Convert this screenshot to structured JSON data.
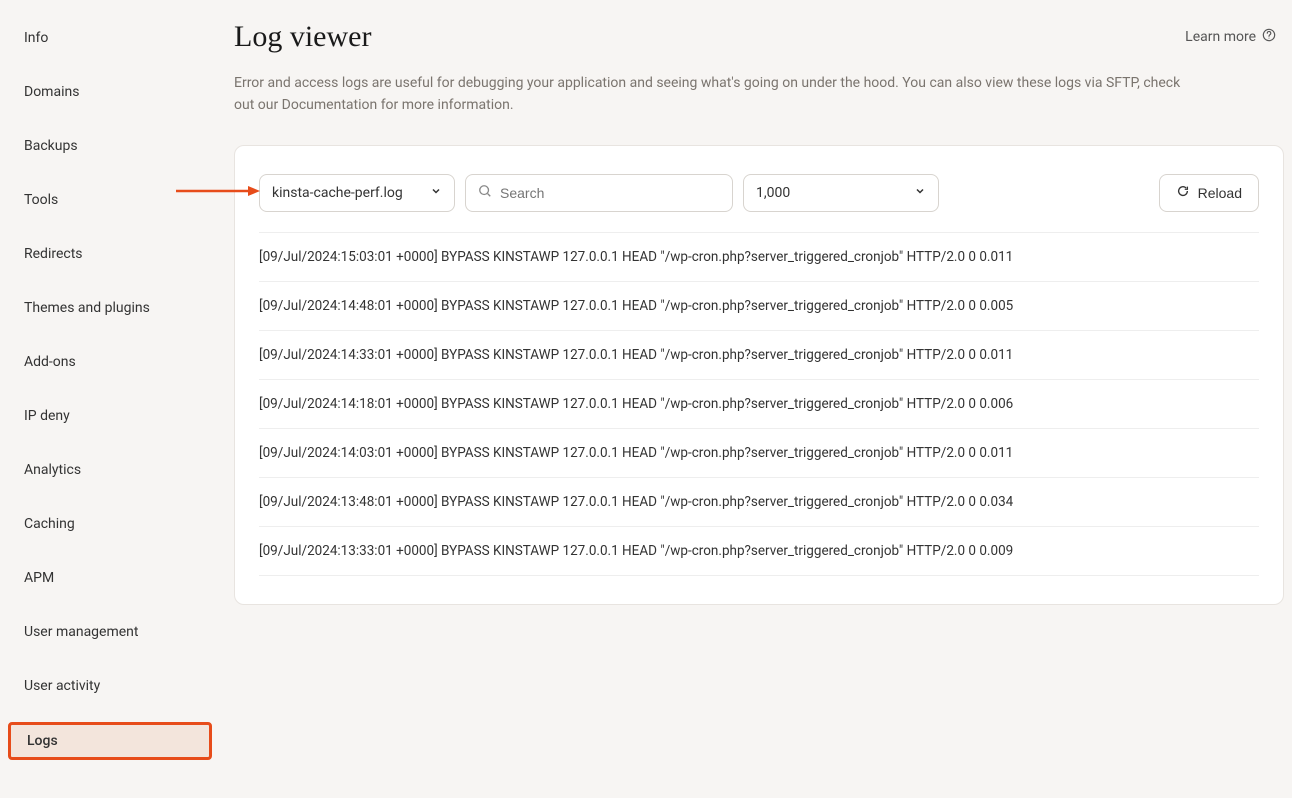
{
  "sidebar": {
    "items": [
      {
        "label": "Info"
      },
      {
        "label": "Domains"
      },
      {
        "label": "Backups"
      },
      {
        "label": "Tools"
      },
      {
        "label": "Redirects"
      },
      {
        "label": "Themes and plugins"
      },
      {
        "label": "Add-ons"
      },
      {
        "label": "IP deny"
      },
      {
        "label": "Analytics"
      },
      {
        "label": "Caching"
      },
      {
        "label": "APM"
      },
      {
        "label": "User management"
      },
      {
        "label": "User activity"
      },
      {
        "label": "Logs"
      }
    ],
    "activeIndex": 13
  },
  "header": {
    "title": "Log viewer",
    "learnMore": "Learn more"
  },
  "description": "Error and access logs are useful for debugging your application and seeing what's going on under the hood. You can also view these logs via SFTP, check out our Documentation for more information.",
  "toolbar": {
    "fileSelect": "kinsta-cache-perf.log",
    "searchPlaceholder": "Search",
    "countSelect": "1,000",
    "reloadLabel": "Reload"
  },
  "logs": [
    "[09/Jul/2024:15:03:01 +0000] BYPASS KINSTAWP 127.0.0.1 HEAD \"/wp-cron.php?server_triggered_cronjob\" HTTP/2.0 0 0.011",
    "[09/Jul/2024:14:48:01 +0000] BYPASS KINSTAWP 127.0.0.1 HEAD \"/wp-cron.php?server_triggered_cronjob\" HTTP/2.0 0 0.005",
    "[09/Jul/2024:14:33:01 +0000] BYPASS KINSTAWP 127.0.0.1 HEAD \"/wp-cron.php?server_triggered_cronjob\" HTTP/2.0 0 0.011",
    "[09/Jul/2024:14:18:01 +0000] BYPASS KINSTAWP 127.0.0.1 HEAD \"/wp-cron.php?server_triggered_cronjob\" HTTP/2.0 0 0.006",
    "[09/Jul/2024:14:03:01 +0000] BYPASS KINSTAWP 127.0.0.1 HEAD \"/wp-cron.php?server_triggered_cronjob\" HTTP/2.0 0 0.011",
    "[09/Jul/2024:13:48:01 +0000] BYPASS KINSTAWP 127.0.0.1 HEAD \"/wp-cron.php?server_triggered_cronjob\" HTTP/2.0 0 0.034",
    "[09/Jul/2024:13:33:01 +0000] BYPASS KINSTAWP 127.0.0.1 HEAD \"/wp-cron.php?server_triggered_cronjob\" HTTP/2.0 0 0.009"
  ]
}
